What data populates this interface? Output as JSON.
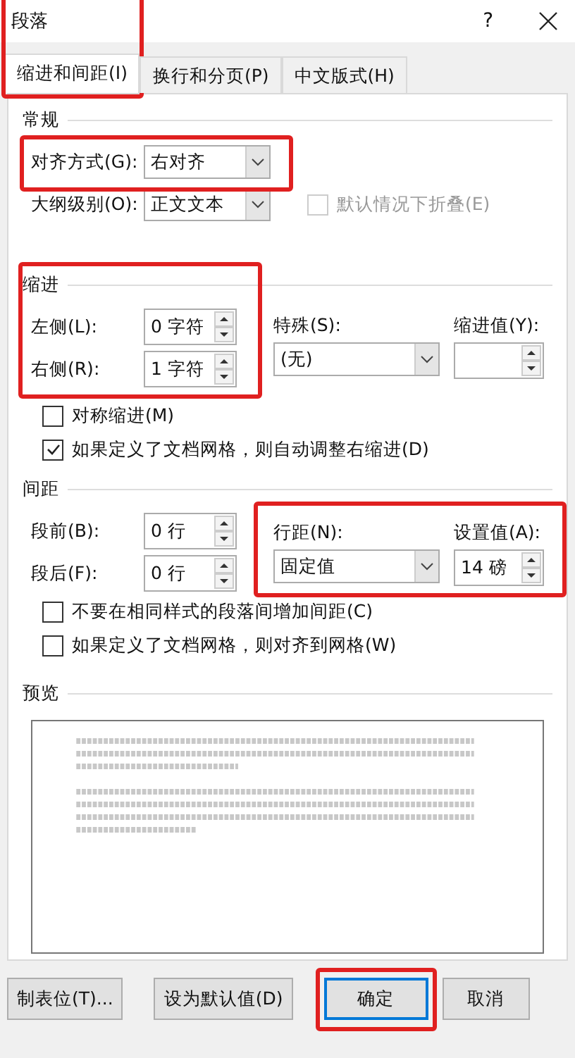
{
  "window": {
    "title": "段落",
    "help_label": "?"
  },
  "title_highlighted": true,
  "tabs": [
    {
      "label": "缩进和间距(I)",
      "selected": true,
      "highlighted": true
    },
    {
      "label": "换行和分页(P)",
      "selected": false,
      "highlighted": false
    },
    {
      "label": "中文版式(H)",
      "selected": false,
      "highlighted": false
    }
  ],
  "general": {
    "heading": "常规",
    "alignment": {
      "label": "对齐方式(G):",
      "value": "右对齐",
      "highlighted": true
    },
    "outline_level": {
      "label": "大纲级别(O):",
      "value": "正文文本"
    },
    "collapse": {
      "label": "默认情况下折叠(E)",
      "checked": false,
      "disabled": true
    }
  },
  "indentation": {
    "heading": "缩进",
    "highlighted": true,
    "left": {
      "label": "左侧(L):",
      "value": "0 字符"
    },
    "right": {
      "label": "右侧(R):",
      "value": "1 字符"
    },
    "special": {
      "label": "特殊(S):",
      "value": "(无)"
    },
    "by": {
      "label": "缩进值(Y):"
    },
    "checkboxes": [
      {
        "label": "对称缩进(M)",
        "checked": false
      },
      {
        "label": "如果定义了文档网格，则自动调整右缩进(D)",
        "checked": true
      }
    ]
  },
  "spacing": {
    "heading": "间距",
    "before": {
      "label": "段前(B):",
      "value": "0 行"
    },
    "after": {
      "label": "段后(F):",
      "value": "0 行"
    },
    "line_highlighted": true,
    "line_spacing": {
      "label": "行距(N):",
      "value": "固定值"
    },
    "at": {
      "label": "设置值(A):",
      "value": "14 磅"
    },
    "checkboxes": [
      {
        "label": "不要在相同样式的段落间增加间距(C)",
        "checked": false
      },
      {
        "label": "如果定义了文档网格，则对齐到网格(W)",
        "checked": false
      }
    ]
  },
  "preview": {
    "heading": "预览"
  },
  "buttons": [
    {
      "label": "制表位(T)...",
      "default": false,
      "highlighted": false
    },
    {
      "label": "设为默认值(D)",
      "default": false,
      "highlighted": false
    },
    {
      "label": "确定",
      "default": true,
      "highlighted": true
    },
    {
      "label": "取消",
      "default": false,
      "highlighted": false
    }
  ]
}
